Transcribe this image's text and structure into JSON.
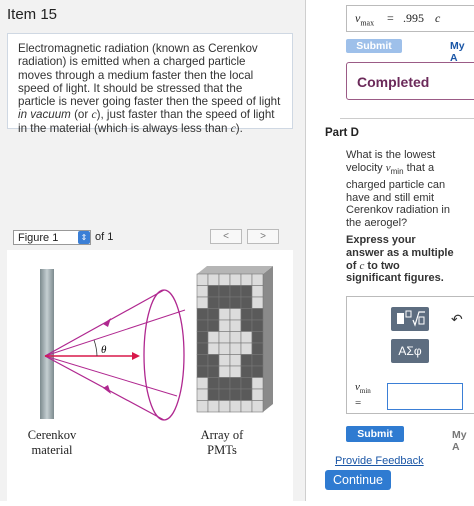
{
  "item": {
    "title": "Item 15"
  },
  "problem": {
    "text_a": "Electromagnetic radiation (known as Cerenkov radiation) is emitted when a charged particle moves through a medium faster then the local speed of light. It should be stressed that the particle is never going faster then the speed of light ",
    "text_italic": "in vacuum",
    "text_b": " (or ",
    "c_symbol": "c",
    "text_c": "), just faster than the speed of light in the material (which is always less than ",
    "text_d": ")."
  },
  "figure": {
    "selector_value": "Figure 1",
    "of_label": "of 1",
    "prev_icon": "chevron-left-icon",
    "next_icon": "chevron-right-icon",
    "angle_label": "θ",
    "caption_left_1": "Cerenkov",
    "caption_left_2": "material",
    "caption_right_1": "Array of",
    "caption_right_2": "PMTs"
  },
  "part_c": {
    "answer_label": "v",
    "answer_sub": "max",
    "equals": "=",
    "answer_value": ".995",
    "answer_unit": "c",
    "submit_label": "Submit",
    "my_answers_label": "My A",
    "status": "Completed"
  },
  "part_d": {
    "title": "Part D",
    "question": "What is the lowest velocity ",
    "question_var": "v",
    "question_sub": "min",
    "question_rest": " that a charged particle can have and still emit Cerenkov radiation in the aerogel?",
    "instruction_a": "Express your answer as a multiple of ",
    "instruction_c": "c",
    "instruction_b": " to two significant figures.",
    "tool_template_icon": "template-icon",
    "tool_symbols_label": "ΑΣφ",
    "undo_icon": "undo-icon",
    "input_label": "v",
    "input_sub": "min",
    "input_eq": "=",
    "input_value": "",
    "submit_label": "Submit",
    "my_answers_label": "My A"
  },
  "footer": {
    "feedback_link": "Provide Feedback",
    "continue_label": "Continue"
  },
  "colors": {
    "accent": "#2f7bd1",
    "completed_border": "#9b5b86",
    "panel_bg": "#f2f2f2"
  }
}
